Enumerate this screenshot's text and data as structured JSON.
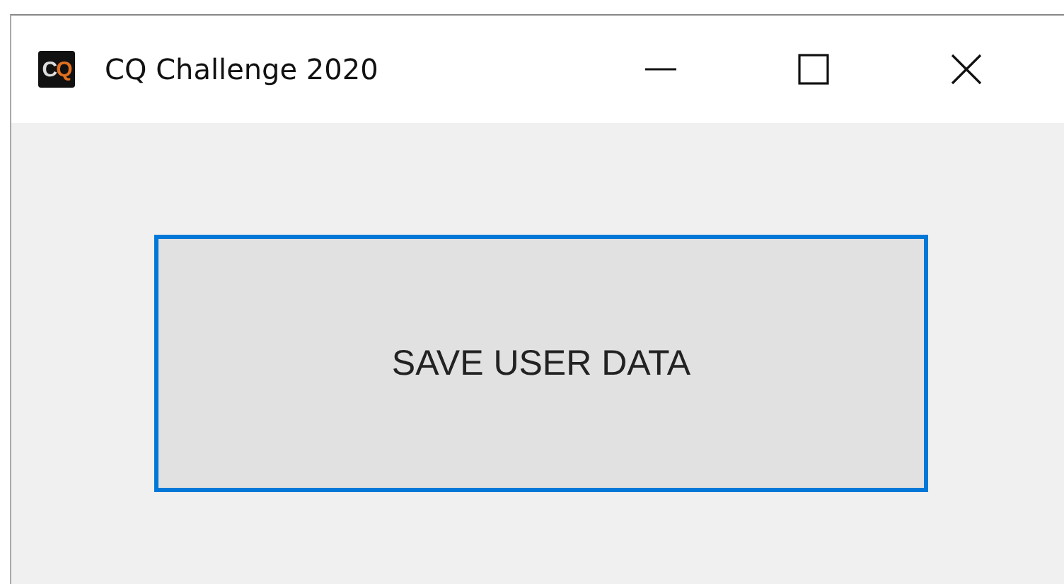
{
  "window": {
    "title": "CQ Challenge 2020",
    "icon_text": "CQ"
  },
  "button": {
    "label": "SAVE USER DATA",
    "focused": true
  }
}
